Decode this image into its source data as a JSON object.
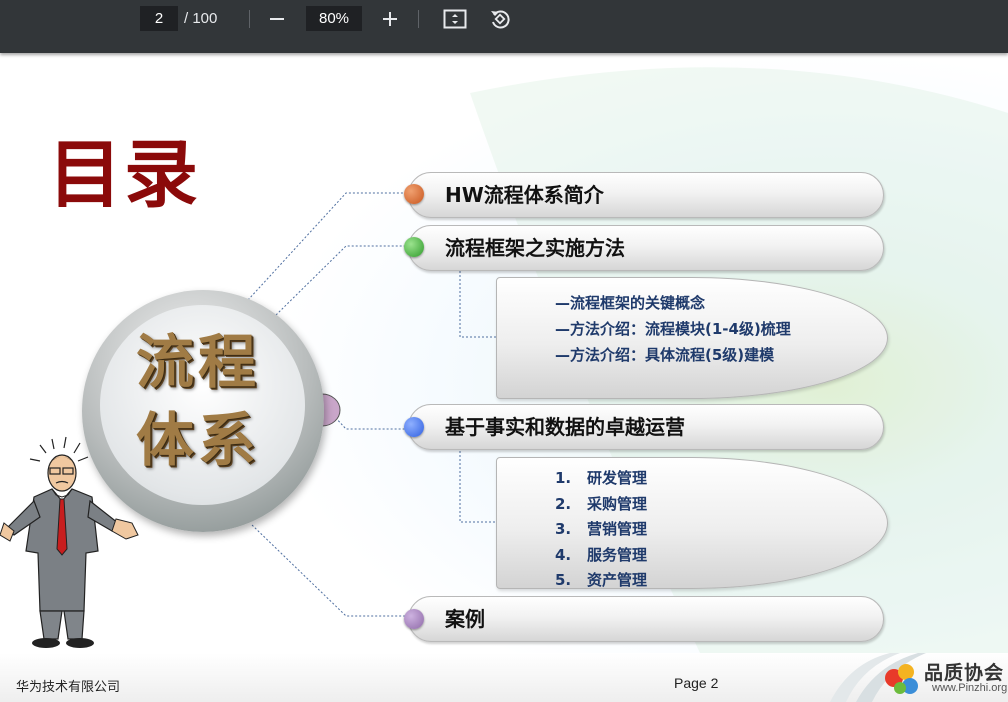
{
  "toolbar": {
    "page_current": "2",
    "page_total": "/ 100",
    "zoom": "80%",
    "icons": [
      "minus-icon",
      "plus-icon",
      "fit-page-icon",
      "rotate-icon"
    ]
  },
  "slide": {
    "title": "目录",
    "circle_line1": "流程",
    "circle_line2": "体系",
    "items": [
      {
        "label": "HW流程体系简介",
        "dot_color": "#c8561e"
      },
      {
        "label": "流程框架之实施方法",
        "dot_color": "#2f9a2a"
      },
      {
        "label": "基于事实和数据的卓越运营",
        "dot_color": "#2f5fe0"
      },
      {
        "label": "案例",
        "dot_color": "#8f6aa8"
      }
    ],
    "method_details": [
      "—流程框架的关键概念",
      "—方法介绍：流程模块(1-4级)梳理",
      "—方法介绍：具体流程(5级)建模"
    ],
    "operations_details": [
      {
        "num": "1.",
        "text": "研发管理"
      },
      {
        "num": "2.",
        "text": "采购管理"
      },
      {
        "num": "3.",
        "text": "营销管理"
      },
      {
        "num": "4.",
        "text": "服务管理"
      },
      {
        "num": "5.",
        "text": "资产管理"
      }
    ]
  },
  "footer": {
    "company": "华为技术有限公司",
    "page": "Page 2",
    "logo_text": "品质协会",
    "logo_url": "www.Pinzhi.org"
  }
}
